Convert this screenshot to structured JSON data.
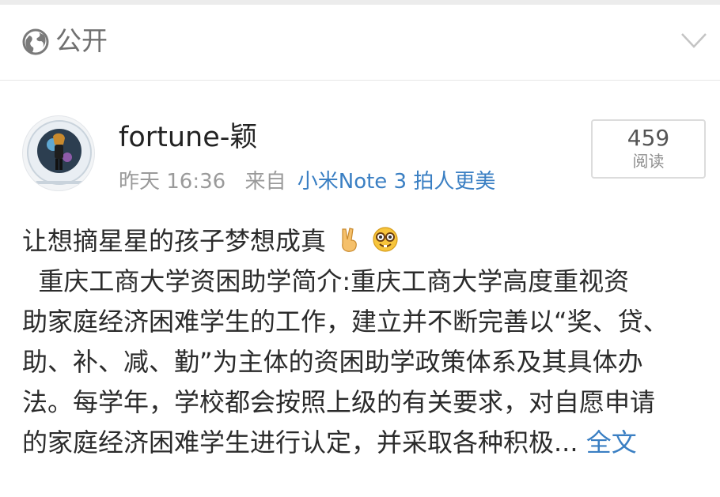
{
  "visibility": {
    "label": "公开",
    "icon": "globe-icon",
    "dropdown_icon": "chevron-down-icon"
  },
  "post": {
    "author": "fortune-颖",
    "time": "昨天 16:36",
    "source_prefix": "来自",
    "source_device": "小米Note 3 拍人更美",
    "read_count": "459",
    "read_label": "阅读",
    "text_line_1": "让想摘星星的孩子梦想成真",
    "emojis": [
      "victory-hand-emoji",
      "nerd-face-emoji"
    ],
    "text_line_2": "  重庆工商大学资困助学简介:重庆工商大学高度重视资",
    "text_line_3": "助家庭经济困难学生的工作，建立并不断完善以“奖、贷、",
    "text_line_4": "助、补、减、勤”为主体的资困助学政策体系及其具体办",
    "text_line_5": "法。每学年，学校都会按照上级的有关要求，对自愿申请",
    "text_line_6": "的家庭经济困难学生进行认定，并采取各种积极... ",
    "expand_label": "全文"
  },
  "colors": {
    "link": "#3a7fc3",
    "muted": "#9a9a9a",
    "text": "#2b2b2b"
  }
}
